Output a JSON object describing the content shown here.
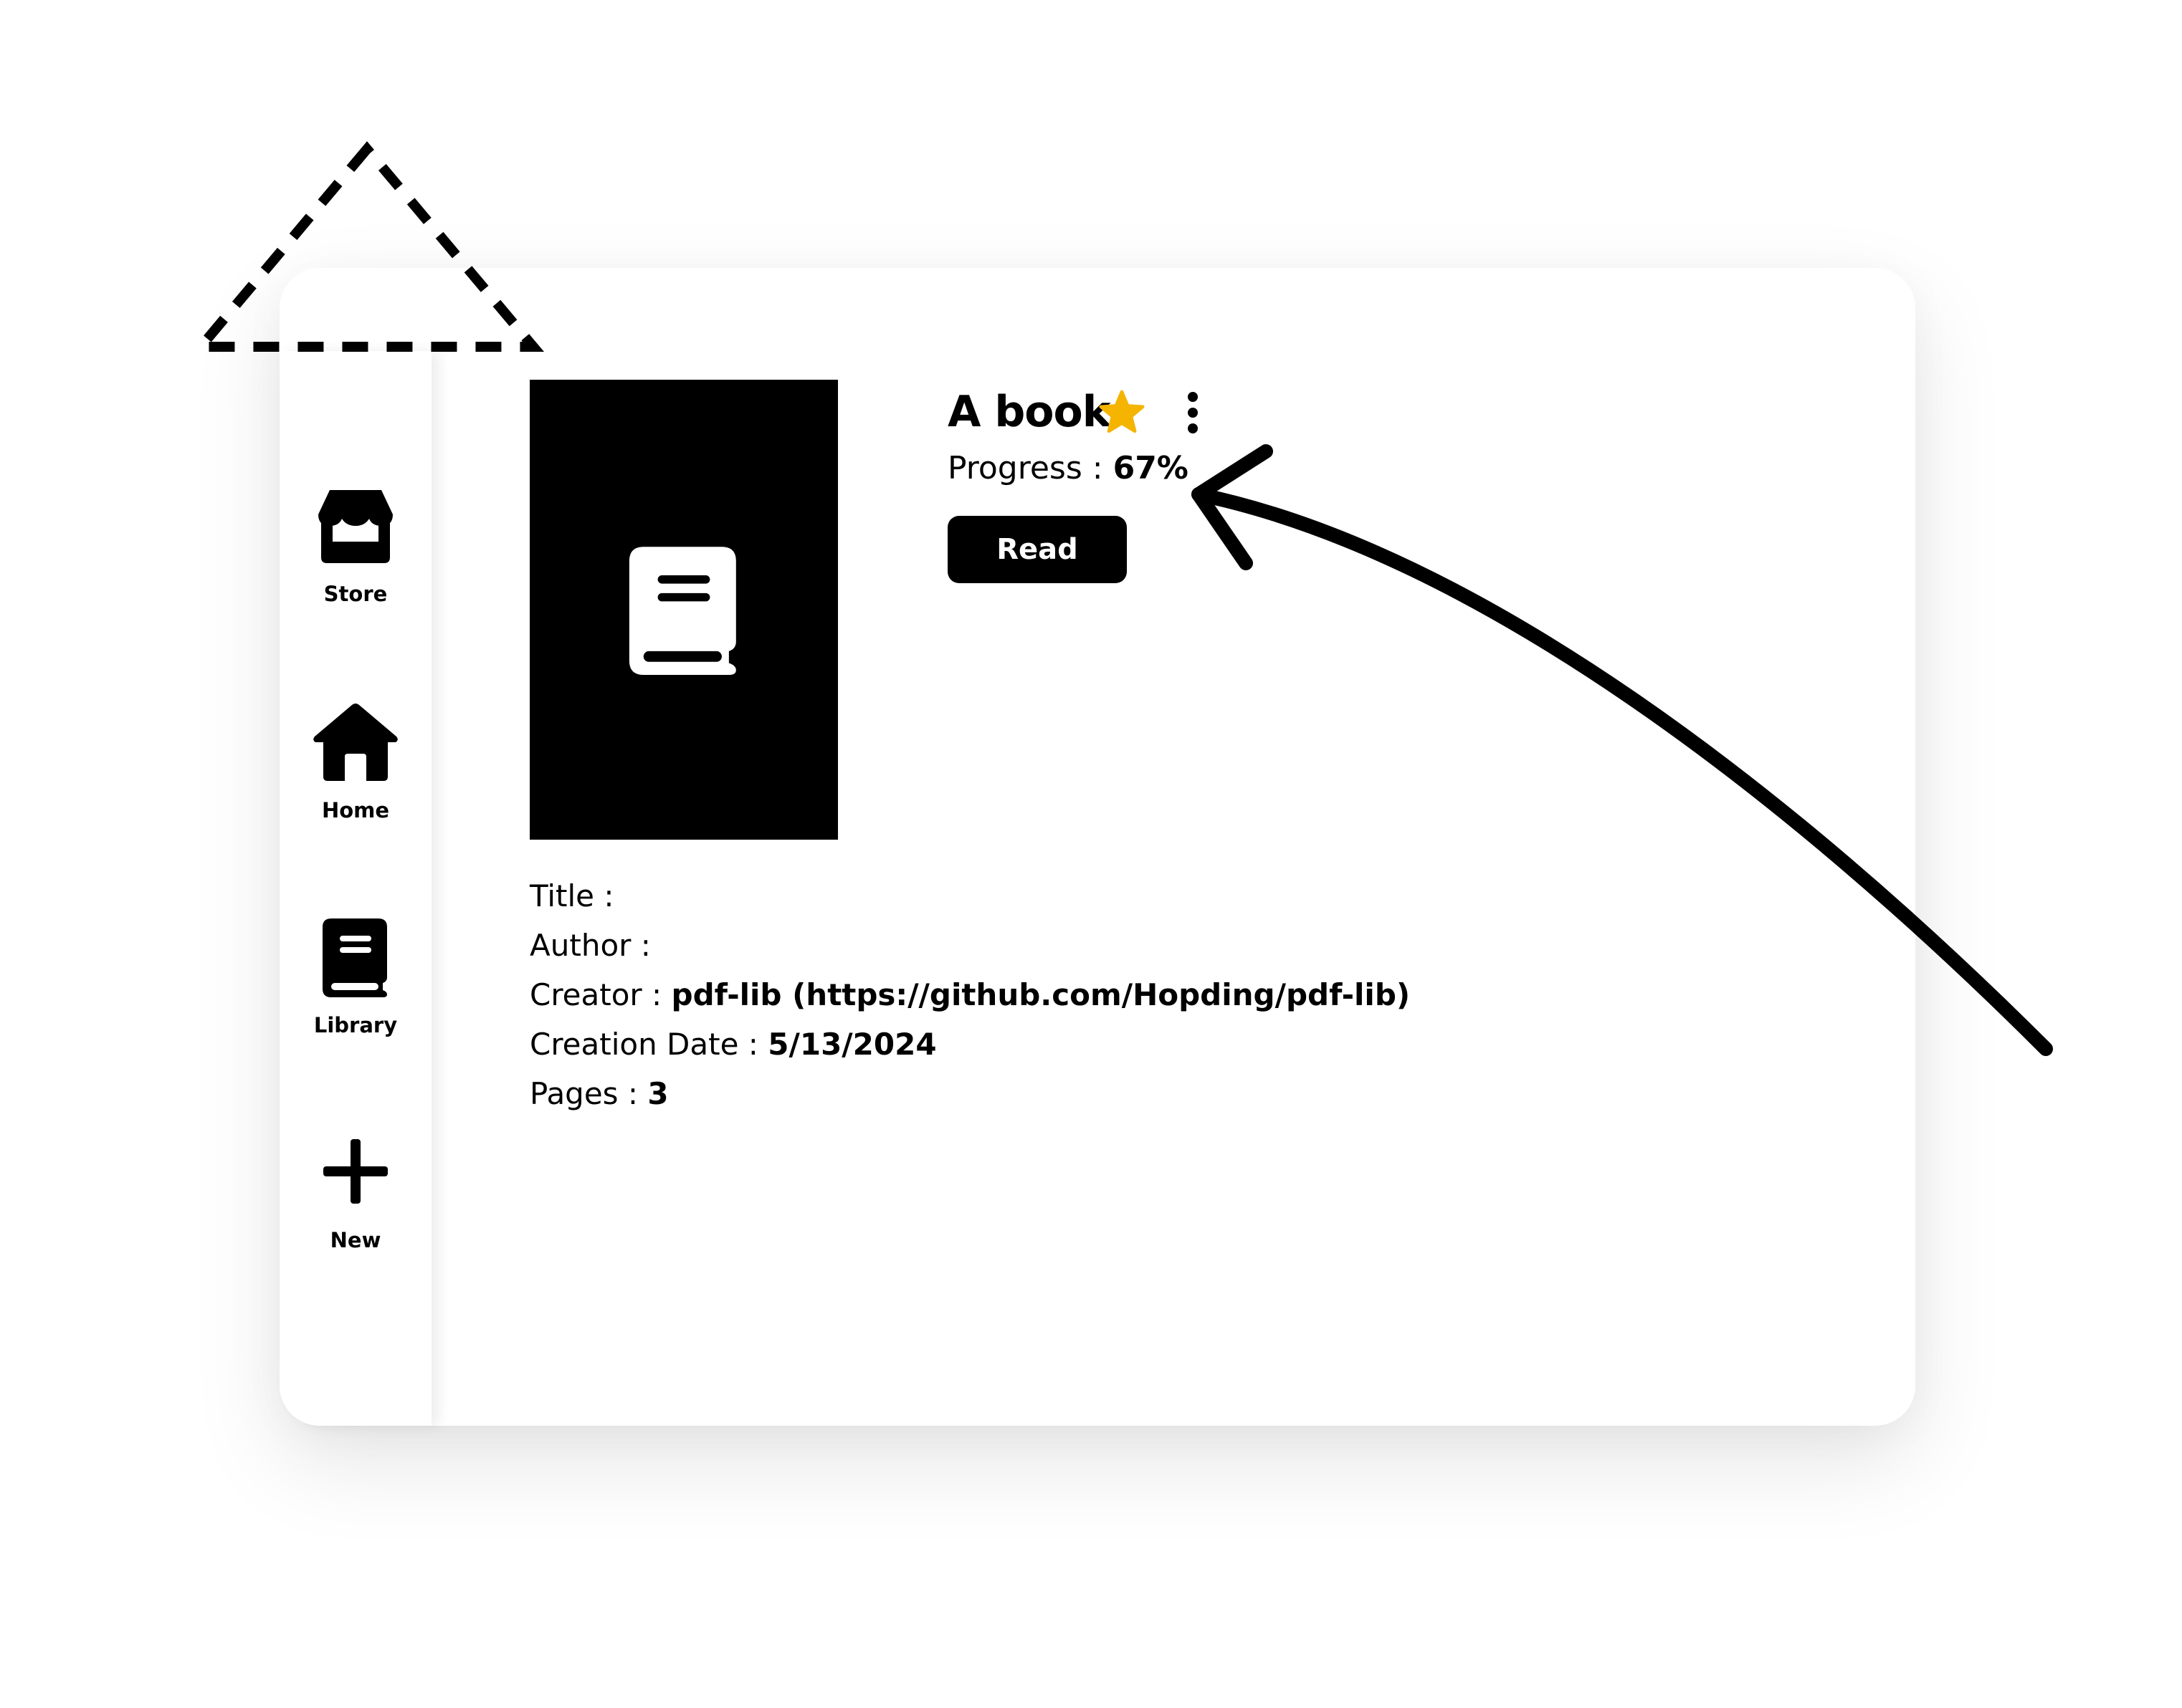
{
  "sidebar": {
    "items": [
      {
        "label": "Store",
        "icon": "store-icon"
      },
      {
        "label": "Home",
        "icon": "home-icon"
      },
      {
        "label": "Library",
        "icon": "book-icon"
      },
      {
        "label": "New",
        "icon": "plus-icon"
      }
    ]
  },
  "book": {
    "name": "A book",
    "favorite_icon": "star-icon",
    "favorite_color": "#F4B400",
    "menu_icon": "vertical-dots-icon",
    "progress_label": "Progress : ",
    "progress_value": "67%",
    "read_label": "Read",
    "cover_icon": "book-icon"
  },
  "meta": {
    "title_label": "Title : ",
    "title_value": "",
    "author_label": "Author : ",
    "author_value": "",
    "creator_label": "Creator : ",
    "creator_value": "pdf-lib (https://github.com/Hopding/pdf-lib)",
    "creation_date_label": "Creation Date : ",
    "creation_date_value": "5/13/2024",
    "pages_label": "Pages : ",
    "pages_value": "3"
  },
  "annotations": {
    "triangle": "dashed-triangle",
    "arrow": "curved-arrow-pointing-to-progress"
  }
}
